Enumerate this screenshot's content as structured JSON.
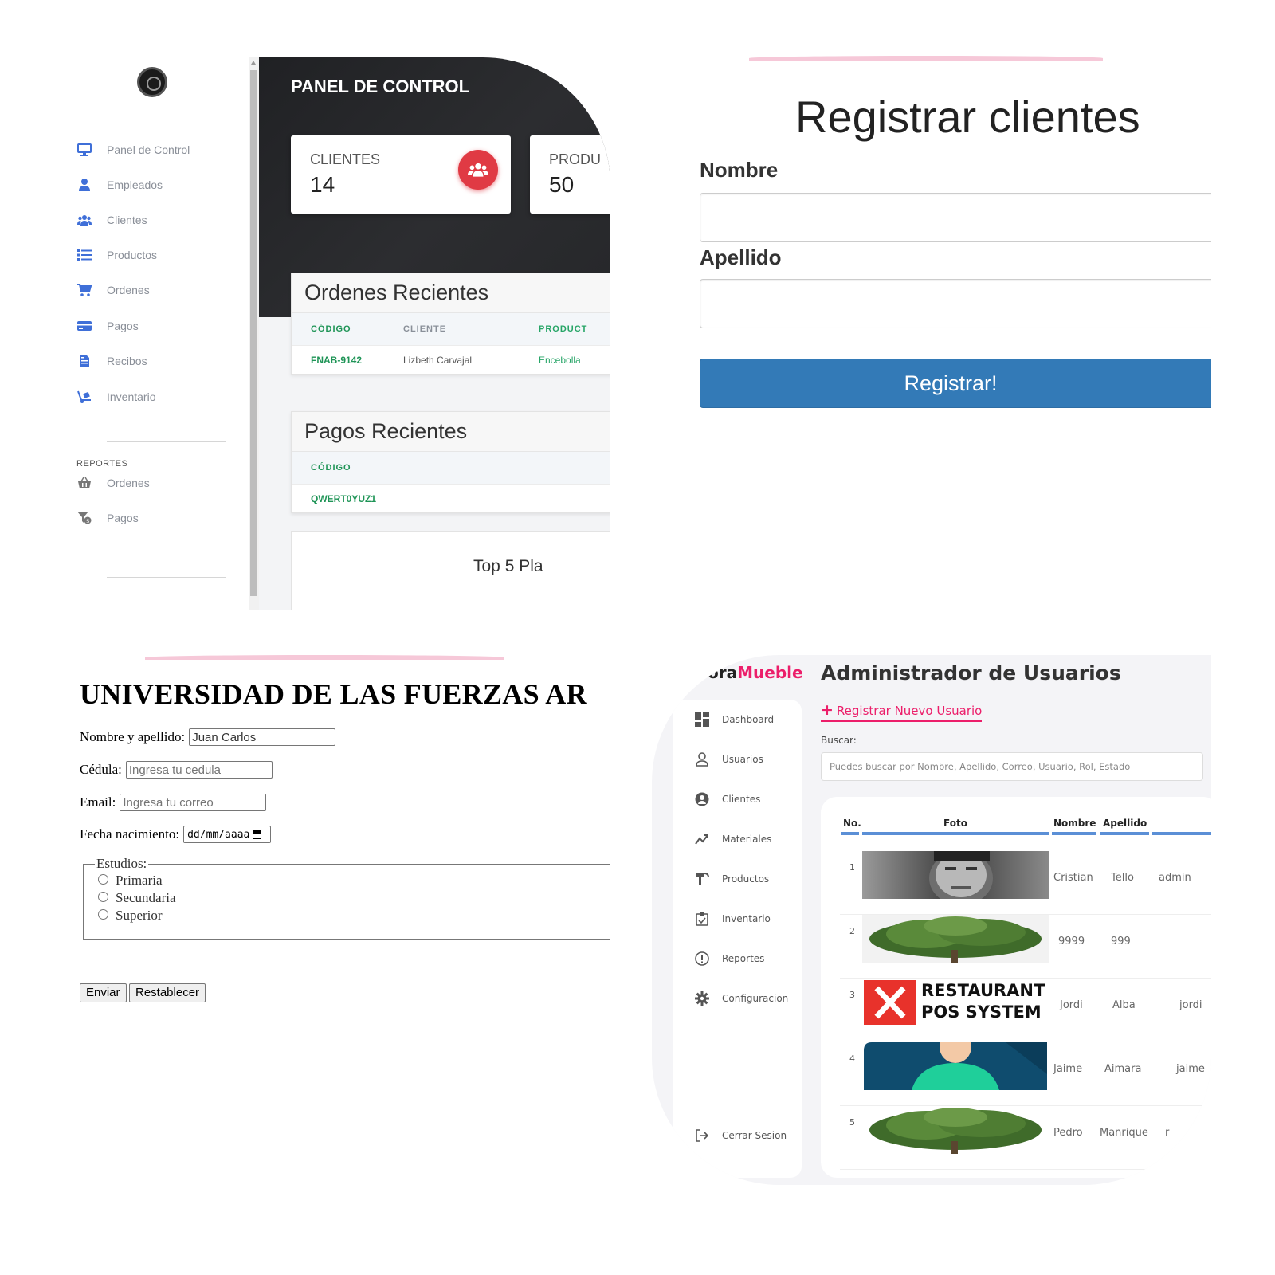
{
  "panel_dashboard": {
    "sidebar": {
      "items": [
        {
          "label": "Panel de Control",
          "icon": "monitor-icon"
        },
        {
          "label": "Empleados",
          "icon": "user-icon"
        },
        {
          "label": "Clientes",
          "icon": "users-icon"
        },
        {
          "label": "Productos",
          "icon": "list-icon"
        },
        {
          "label": "Ordenes",
          "icon": "cart-icon"
        },
        {
          "label": "Pagos",
          "icon": "credit-card-icon"
        },
        {
          "label": "Recibos",
          "icon": "file-invoice-icon"
        },
        {
          "label": "Inventario",
          "icon": "dolly-icon"
        }
      ],
      "section_label": "REPORTES",
      "report_items": [
        {
          "label": "Ordenes",
          "icon": "basket-icon"
        },
        {
          "label": "Pagos",
          "icon": "funnel-dollar-icon"
        }
      ]
    },
    "header_title": "PANEL DE CONTROL",
    "cards": [
      {
        "label": "CLIENTES",
        "value": "14"
      },
      {
        "label": "PRODU",
        "value": "50"
      }
    ],
    "ordenes": {
      "title": "Ordenes Recientes",
      "columns": [
        "CÓDIGO",
        "CLIENTE",
        "PRODUCT"
      ],
      "rows": [
        [
          "FNAB-9142",
          "Lizbeth Carvajal",
          "Encebolla"
        ]
      ]
    },
    "pagos": {
      "title": "Pagos Recientes",
      "columns": [
        "CÓDIGO"
      ],
      "rows": [
        [
          "QWERT0YUZ1"
        ]
      ]
    },
    "top5_title": "Top 5 Pla"
  },
  "panel_registro": {
    "title": "Registrar clientes",
    "nombre_label": "Nombre",
    "apellido_label": "Apellido",
    "submit_label": "Registrar!"
  },
  "panel_universidad": {
    "title": "UNIVERSIDAD DE LAS FUERZAS AR",
    "fields": {
      "nombre_label": "Nombre y apellido:",
      "nombre_value": "Juan Carlos",
      "cedula_label": "Cédula:",
      "cedula_placeholder": "Ingresa tu cedula",
      "email_label": "Email:",
      "email_placeholder": "Ingresa tu correo",
      "fecha_label": "Fecha nacimiento:",
      "fecha_placeholder": "dd/mm/aaaa"
    },
    "estudios": {
      "legend": "Estudios:",
      "options": [
        "Primaria",
        "Secundaria",
        "Superior"
      ]
    },
    "buttons": {
      "enviar": "Enviar",
      "restablecer": "Restablecer"
    }
  },
  "panel_usuarios": {
    "brand_prefix": "ora",
    "brand_accent": "Mueble",
    "title": "Administrador de Usuarios",
    "register_link": "Registrar Nuevo Usuario",
    "search_label": "Buscar:",
    "search_placeholder": "Puedes buscar por Nombre, Apellido, Correo, Usuario, Rol, Estado",
    "nav": [
      {
        "label": "Dashboard",
        "icon": "dashboard-icon"
      },
      {
        "label": "Usuarios",
        "icon": "user-outline-icon"
      },
      {
        "label": "Clientes",
        "icon": "user-circle-icon"
      },
      {
        "label": "Materiales",
        "icon": "chart-line-icon"
      },
      {
        "label": "Productos",
        "icon": "tool-icon"
      },
      {
        "label": "Inventario",
        "icon": "clipboard-icon"
      },
      {
        "label": "Reportes",
        "icon": "alert-circle-icon"
      },
      {
        "label": "Configuracion",
        "icon": "gear-icon"
      }
    ],
    "logout_label": "Cerrar Sesion",
    "columns": [
      "No.",
      "Foto",
      "Nombre",
      "Apellido"
    ],
    "rows": [
      {
        "no": "1",
        "photo": "portrait",
        "nombre": "Cristian",
        "apellido": "Tello",
        "extra": "admin"
      },
      {
        "no": "2",
        "photo": "tree",
        "nombre": "9999",
        "apellido": "999",
        "extra": ""
      },
      {
        "no": "3",
        "photo": "restaurant-logo",
        "nombre": "Jordi",
        "apellido": "Alba",
        "extra": "jordi"
      },
      {
        "no": "4",
        "photo": "avatar",
        "nombre": "Jaime",
        "apellido": "Aimara",
        "extra": "jaime"
      },
      {
        "no": "5",
        "photo": "tree",
        "nombre": "Pedro",
        "apellido": "Manrique",
        "extra": "r"
      }
    ],
    "restaurant_logo_text": [
      "RESTAURANT",
      "POS SYSTEM"
    ],
    "colors": {
      "accent": "#ec1e6a",
      "table_line": "#5b8fd6"
    }
  },
  "colors": {
    "dashboard_dark": "#202124",
    "badge_red": "#e03a44",
    "green_text": "#27a567",
    "register_blue": "#337ab7"
  }
}
